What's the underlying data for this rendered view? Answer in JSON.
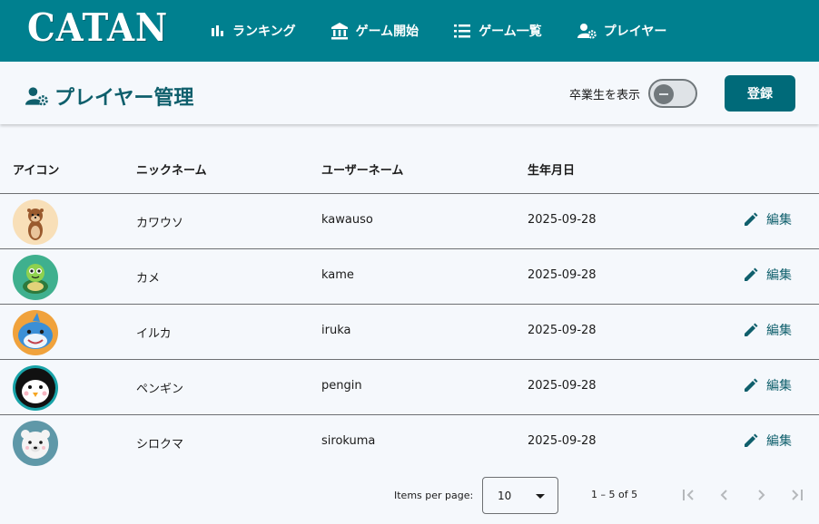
{
  "app": {
    "logo": "CATAN"
  },
  "nav": {
    "ranking": "ランキング",
    "start_game": "ゲーム開始",
    "game_list": "ゲーム一覧",
    "players": "プレイヤー"
  },
  "header": {
    "title": "プレイヤー管理",
    "toggle_label": "卒業生を表示",
    "toggle_on": false,
    "register_label": "登録"
  },
  "table": {
    "columns": {
      "icon": "アイコン",
      "nickname": "ニックネーム",
      "username": "ユーザーネーム",
      "birthday": "生年月日"
    },
    "edit_label": "編集",
    "rows": [
      {
        "nickname": "カワウソ",
        "username": "kawauso",
        "birthday": "2025-09-28",
        "avatar": "otter",
        "avatar_bg": "#f8dfb8"
      },
      {
        "nickname": "カメ",
        "username": "kame",
        "birthday": "2025-09-28",
        "avatar": "turtle",
        "avatar_bg": "#3fb08e"
      },
      {
        "nickname": "イルカ",
        "username": "iruka",
        "birthday": "2025-09-28",
        "avatar": "dolphin",
        "avatar_bg": "#f0a23c"
      },
      {
        "nickname": "ペンギン",
        "username": "pengin",
        "birthday": "2025-09-28",
        "avatar": "penguin",
        "avatar_bg": "#18a3a8"
      },
      {
        "nickname": "シロクマ",
        "username": "sirokuma",
        "birthday": "2025-09-28",
        "avatar": "polar-bear",
        "avatar_bg": "#5f98a8"
      }
    ]
  },
  "paginator": {
    "items_per_page_label": "Items per page:",
    "page_size": "10",
    "range_label": "1 – 5 of 5"
  },
  "colors": {
    "primary": "#00808f",
    "button": "#006a79",
    "accent_text": "#0f5f6c"
  }
}
